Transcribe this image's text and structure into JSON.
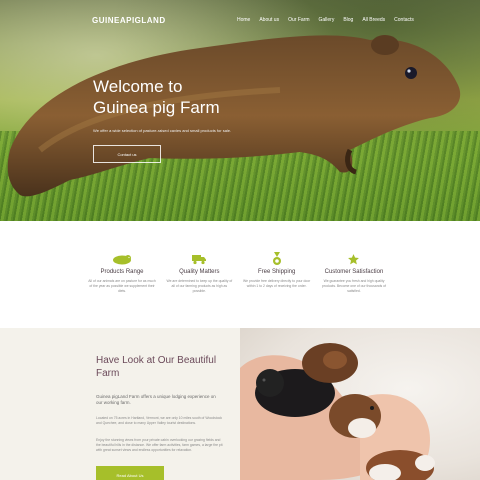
{
  "header": {
    "logo": "GUINEAPIGLAND",
    "nav": [
      "Home",
      "About us",
      "Our Farm",
      "Gallery",
      "Blog",
      "All Breeds",
      "Contacts"
    ]
  },
  "hero": {
    "title_line1": "Welcome to",
    "title_line2": "Guinea pig Farm",
    "subtitle": "We offer a wide selection of pasture-raised cavies and small products for sale.",
    "button": "Contact us"
  },
  "features": [
    {
      "icon": "guinea-pig-icon",
      "title": "Products Range",
      "desc": "All of our animals are on pasture for as much of the year as possible we supplement their diets."
    },
    {
      "icon": "truck-icon",
      "title": "Quality Matters",
      "desc": "We are determined to keep up the quality of all of our farming products as high as possible."
    },
    {
      "icon": "medal-icon",
      "title": "Free Shipping",
      "desc": "We provide free delivery directly to your door within 1 to 2 days of receiving the order."
    },
    {
      "icon": "star-icon",
      "title": "Customer Satisfaction",
      "desc": "We guarantee you fresh and high quality products. Become one of our thousands of satisfied."
    }
  ],
  "farm": {
    "title": "Have Look at Our Beautiful Farm",
    "p1": "Guinea pigLand Farm offers a unique lodging experience on our working farm.",
    "p2": "Located on 75 acres in Hartland, Vermont, we are only 10 miles south of Woodstock and Quechee, and close to many Upper Valley tourist destinations.",
    "p3": "Enjoy the stunning views from your private cabin overlooking our grazing fields and the beautiful hills in the distance. We offer farm activities, farm games, a large fire pit with great sunset views and endless opportunities for relaxation.",
    "button": "Read About Us"
  },
  "colors": {
    "accent": "#a6bf2a",
    "heading": "#6b4a5a",
    "feature_title": "#4a3d44",
    "farm_bg": "#f4f2eb"
  }
}
